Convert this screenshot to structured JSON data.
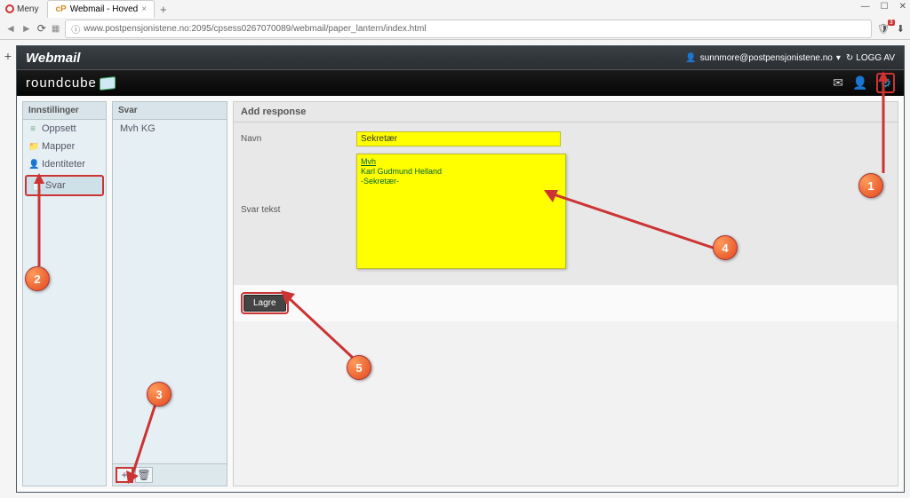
{
  "browser": {
    "meny": "Meny",
    "tab_title": "Webmail - Hoved",
    "url": "www.postpensjonistene.no:2095/cpsess0267070089/webmail/paper_lantern/index.html",
    "win_min": "—",
    "win_max": "☐",
    "win_close": "✕"
  },
  "topbar": {
    "brand": "Webmail",
    "user": "sunnmore@postpensjonistene.no",
    "logoff": "LOGG AV"
  },
  "rcbar": {
    "brand": "roundcube"
  },
  "sidebar": {
    "header": "Innstillinger",
    "items": [
      {
        "label": "Oppsett"
      },
      {
        "label": "Mapper"
      },
      {
        "label": "Identiteter"
      },
      {
        "label": "Svar"
      }
    ]
  },
  "responses": {
    "header": "Svar",
    "items": [
      {
        "label": "Mvh KG"
      }
    ],
    "add": "+",
    "del": "🗑"
  },
  "main": {
    "header": "Add response",
    "name_label": "Navn",
    "name_value": "Sekretær",
    "text_label": "Svar tekst",
    "text_line1": "Mvh",
    "text_line2": "Karl Gudmund Helland",
    "text_line3": "-Sekretær-",
    "save": "Lagre"
  },
  "bubbles": {
    "b1": "1",
    "b2": "2",
    "b3": "3",
    "b4": "4",
    "b5": "5"
  }
}
